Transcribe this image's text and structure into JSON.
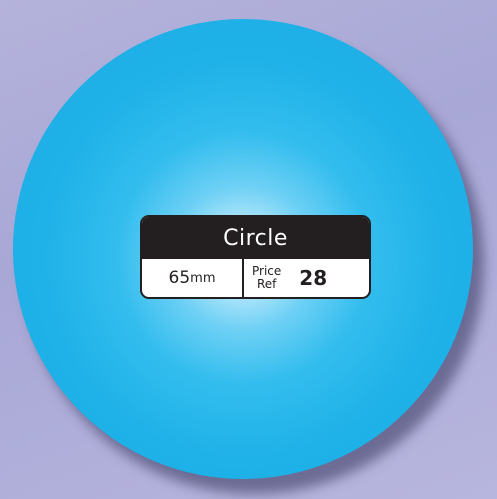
{
  "label": {
    "title": "Circle",
    "size_value": "65",
    "size_unit": "mm",
    "price_word": "Price",
    "ref_word": "Ref",
    "price_ref_number": "28"
  },
  "colors": {
    "circle_center": "#e9f8ff",
    "circle_edge": "#1aabe2",
    "background": "#b4b3db",
    "label_dark": "#231f20"
  }
}
